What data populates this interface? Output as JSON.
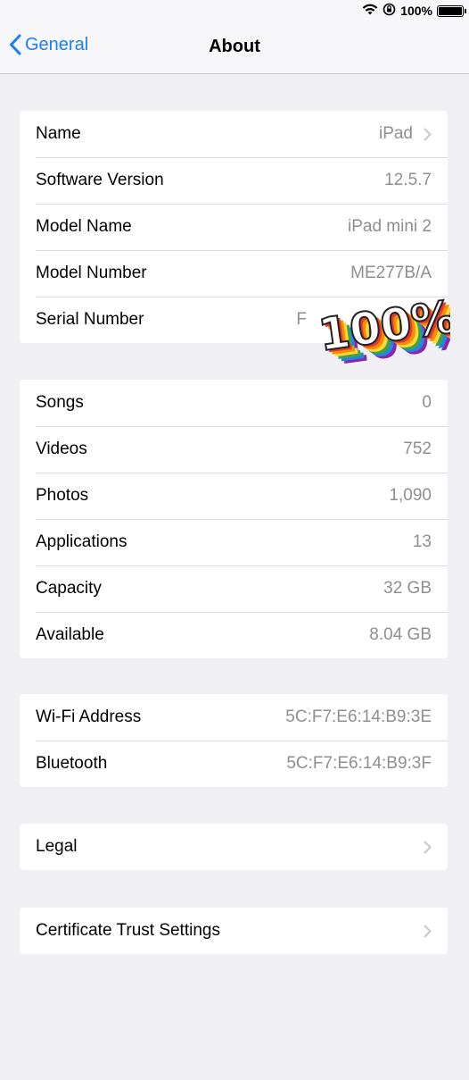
{
  "status": {
    "battery_percent": "100%",
    "battery_level": 1.0
  },
  "nav": {
    "back_label": "General",
    "title": "About"
  },
  "device_info": [
    {
      "label": "Name",
      "value": "iPad",
      "chevron": true
    },
    {
      "label": "Software Version",
      "value": "12.5.7"
    },
    {
      "label": "Model Name",
      "value": "iPad mini 2"
    },
    {
      "label": "Model Number",
      "value": "ME277B/A"
    },
    {
      "label": "Serial Number",
      "value": "F"
    }
  ],
  "media_info": [
    {
      "label": "Songs",
      "value": "0"
    },
    {
      "label": "Videos",
      "value": "752"
    },
    {
      "label": "Photos",
      "value": "1,090"
    },
    {
      "label": "Applications",
      "value": "13"
    },
    {
      "label": "Capacity",
      "value": "32 GB"
    },
    {
      "label": "Available",
      "value": "8.04 GB"
    }
  ],
  "network_info": [
    {
      "label": "Wi-Fi Address",
      "value": "5C:F7:E6:14:B9:3E"
    },
    {
      "label": "Bluetooth",
      "value": "5C:F7:E6:14:B9:3F"
    }
  ],
  "legal": {
    "label": "Legal"
  },
  "certificate": {
    "label": "Certificate Trust Settings"
  },
  "sticker": {
    "text": "100%",
    "colors": [
      "#e53935",
      "#fb8c00",
      "#fdd835",
      "#43a047",
      "#1e88e5",
      "#8e24aa"
    ]
  }
}
